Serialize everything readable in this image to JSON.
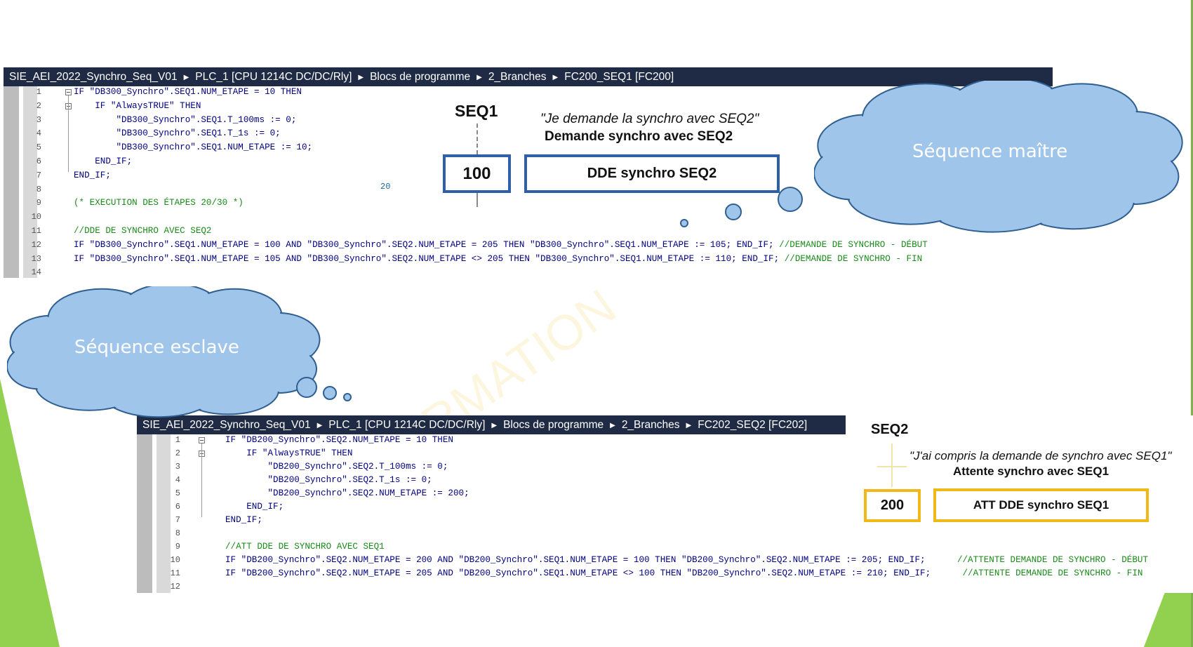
{
  "panel_master": {
    "breadcrumb": [
      "SIE_AEI_2022_Synchro_Seq_V01",
      "PLC_1 [CPU 1214C DC/DC/Rly]",
      "Blocs de programme",
      "2_Branches",
      "FC200_SEQ1 [FC200]"
    ],
    "lines": [
      {
        "n": "1",
        "code": "IF \"DB300_Synchro\".SEQ1.NUM_ETAPE = 10 THEN"
      },
      {
        "n": "2",
        "code": "    IF \"AlwaysTRUE\" THEN"
      },
      {
        "n": "3",
        "code": "        \"DB300_Synchro\".SEQ1.T_100ms := 0;"
      },
      {
        "n": "4",
        "code": "        \"DB300_Synchro\".SEQ1.T_1s := 0;"
      },
      {
        "n": "5",
        "code": "        \"DB300_Synchro\".SEQ1.NUM_ETAPE := 10;"
      },
      {
        "n": "6",
        "code": "    END_IF;"
      },
      {
        "n": "7",
        "code": "END_IF;"
      },
      {
        "n": "8",
        "code": ""
      },
      {
        "n": "9",
        "code": "(* EXECUTION DES ÉTAPES 20/30 *)",
        "comment": true
      },
      {
        "n": "10",
        "code": ""
      },
      {
        "n": "11",
        "code": "//DDE DE SYNCHRO AVEC SEQ2",
        "comment": true
      },
      {
        "n": "12",
        "code": "IF \"DB300_Synchro\".SEQ1.NUM_ETAPE = 100 AND \"DB300_Synchro\".SEQ2.NUM_ETAPE = 205 THEN \"DB300_Synchro\".SEQ1.NUM_ETAPE := 105; END_IF; ",
        "tail": "//DEMANDE DE SYNCHRO - DÉBUT"
      },
      {
        "n": "13",
        "code": "IF \"DB300_Synchro\".SEQ1.NUM_ETAPE = 105 AND \"DB300_Synchro\".SEQ2.NUM_ETAPE <> 205 THEN \"DB300_Synchro\".SEQ1.NUM_ETAPE := 110; END_IF; ",
        "tail": "//DEMANDE DE SYNCHRO - FIN"
      },
      {
        "n": "14",
        "code": ""
      }
    ],
    "stray_number": "20"
  },
  "panel_slave": {
    "breadcrumb": [
      "SIE_AEI_2022_Synchro_Seq_V01",
      "PLC_1 [CPU 1214C DC/DC/Rly]",
      "Blocs de programme",
      "2_Branches",
      "FC202_SEQ2 [FC202]"
    ],
    "lines": [
      {
        "n": "1",
        "code": "IF \"DB200_Synchro\".SEQ2.NUM_ETAPE = 10 THEN"
      },
      {
        "n": "2",
        "code": "    IF \"AlwaysTRUE\" THEN"
      },
      {
        "n": "3",
        "code": "        \"DB200_Synchro\".SEQ2.T_100ms := 0;"
      },
      {
        "n": "4",
        "code": "        \"DB200_Synchro\".SEQ2.T_1s := 0;"
      },
      {
        "n": "5",
        "code": "        \"DB200_Synchro\".SEQ2.NUM_ETAPE := 200;"
      },
      {
        "n": "6",
        "code": "    END_IF;"
      },
      {
        "n": "7",
        "code": "END_IF;"
      },
      {
        "n": "8",
        "code": ""
      },
      {
        "n": "9",
        "code": "//ATT DDE DE SYNCHRO AVEC SEQ1",
        "comment": true
      },
      {
        "n": "10",
        "code": "IF \"DB200_Synchro\".SEQ2.NUM_ETAPE = 200 AND \"DB200_Synchro\".SEQ1.NUM_ETAPE = 100 THEN \"DB200_Synchro\".SEQ2.NUM_ETAPE := 205; END_IF;      ",
        "tail": "//ATTENTE DEMANDE DE SYNCHRO - DÉBUT"
      },
      {
        "n": "11",
        "code": "IF \"DB200_Synchro\".SEQ2.NUM_ETAPE = 205 AND \"DB200_Synchro\".SEQ1.NUM_ETAPE <> 100 THEN \"DB200_Synchro\".SEQ2.NUM_ETAPE := 210; END_IF;      ",
        "tail": "//ATTENTE DEMANDE DE SYNCHRO - FIN"
      },
      {
        "n": "12",
        "code": ""
      }
    ]
  },
  "seq1_diagram": {
    "title": "SEQ1",
    "quote": "\"Je demande la synchro avec SEQ2\"",
    "description": "Demande synchro avec SEQ2",
    "step": "100",
    "action": "DDE synchro SEQ2",
    "color": "#2e5fa8"
  },
  "seq2_diagram": {
    "title": "SEQ2",
    "quote": "\"J'ai compris la demande de synchro avec SEQ1\"",
    "description": "Attente synchro avec SEQ1",
    "step": "200",
    "action": "ATT DDE synchro SEQ1",
    "color": "#f2b817"
  },
  "clouds": {
    "master_label": "Séquence maître",
    "slave_label": "Séquence esclave",
    "fill": "#9fc5ea",
    "stroke": "#2f5f91"
  },
  "watermark": "RMATION",
  "accent_green": "#92d050"
}
